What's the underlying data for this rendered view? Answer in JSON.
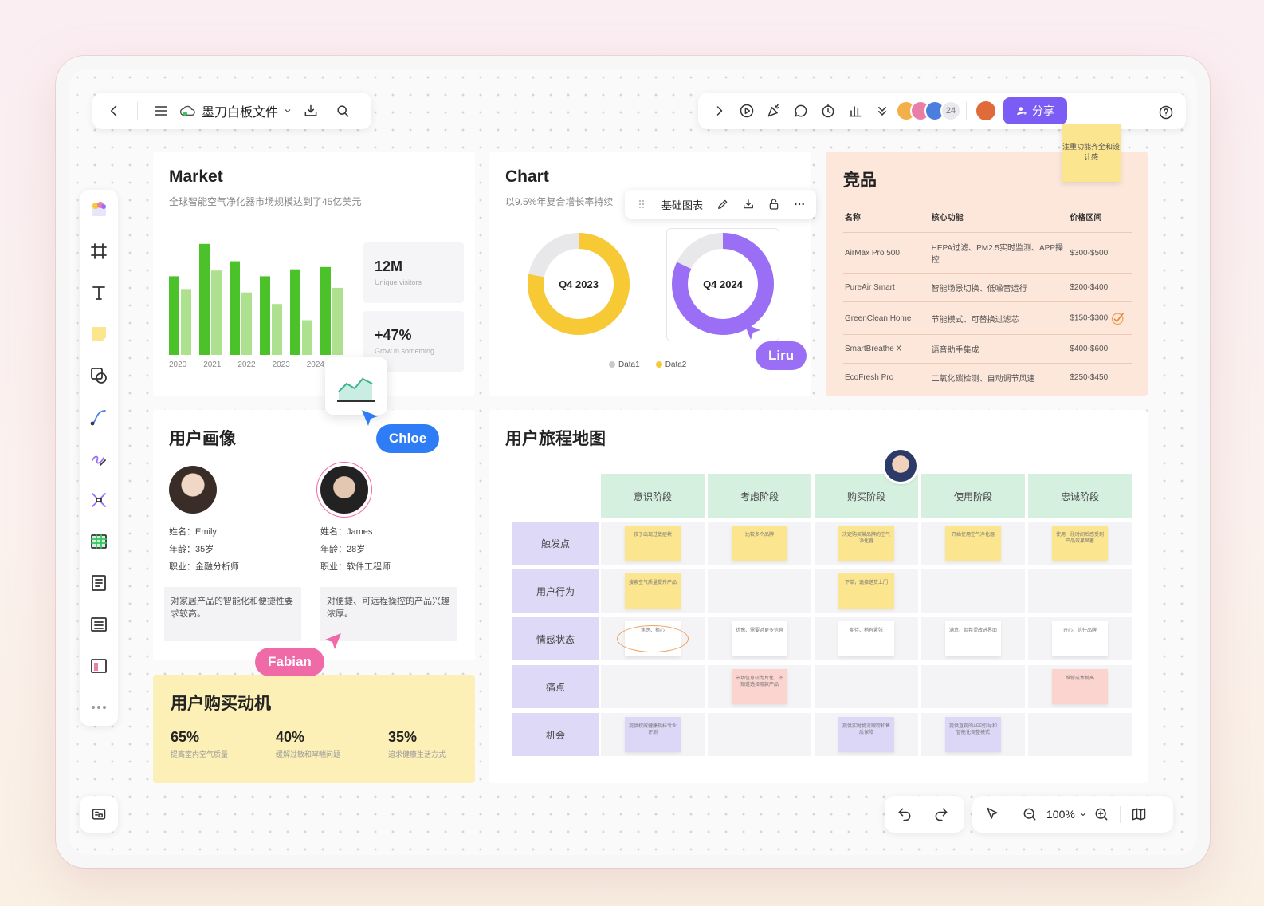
{
  "toolbar": {
    "doc_title": "墨刀白板文件",
    "share_label": "分享",
    "collaborator_count": "24"
  },
  "market": {
    "title": "Market",
    "subtitle": "全球智能空气净化器市场规模达到了45亿美元",
    "years": [
      "2020",
      "2021",
      "2022",
      "2023",
      "2024"
    ],
    "bars": [
      [
        68,
        57
      ],
      [
        96,
        73
      ],
      [
        81,
        54
      ],
      [
        68,
        44
      ],
      [
        74,
        30
      ],
      [
        76,
        58
      ]
    ],
    "stat1_value": "12M",
    "stat1_label": "Unique visitors",
    "stat2_value": "+47%",
    "stat2_label": "Grow in something"
  },
  "chart": {
    "title": "Chart",
    "subtitle": "以9.5%年复合增长率持续",
    "toolbar_label": "基础图表",
    "donut1_label": "Q4 2023",
    "donut2_label": "Q4 2024",
    "donut1_fraction": 0.78,
    "donut2_fraction": 0.82,
    "legend": [
      "Data1",
      "Data2"
    ],
    "colors": {
      "data1": "#c9c9cc",
      "data2": "#f6c935",
      "purple": "#9b6ff5",
      "track": "#e8e8ea"
    }
  },
  "compete": {
    "title": "竞品",
    "headers": [
      "名称",
      "核心功能",
      "价格区间"
    ],
    "rows": [
      [
        "AirMax Pro 500",
        "HEPA过滤、PM2.5实时监测、APP操控",
        "$300-$500"
      ],
      [
        "PureAir Smart",
        "智能场景切换、低噪音运行",
        "$200-$400"
      ],
      [
        "GreenClean Home",
        "节能模式、可替换过滤芯",
        "$150-$300"
      ],
      [
        "SmartBreathe X",
        "语音助手集成",
        "$400-$600"
      ],
      [
        "EcoFresh Pro",
        "二氧化碳检测、自动调节风速",
        "$250-$450"
      ]
    ],
    "sticky": "注重功能齐全和设计感"
  },
  "persona": {
    "title": "用户画像",
    "p1": {
      "name": "姓名：Emily",
      "age": "年龄：35岁",
      "job": "职业：金融分析师",
      "quote": "对家居产品的智能化和便捷性要求较高。"
    },
    "p2": {
      "name": "姓名：James",
      "age": "年龄：28岁",
      "job": "职业：软件工程师",
      "quote": "对便捷、可远程操控的产品兴趣浓厚。"
    }
  },
  "motive": {
    "title": "用户购买动机",
    "stats": [
      {
        "value": "65%",
        "label": "提高室内空气质量"
      },
      {
        "value": "40%",
        "label": "缓解过敏和哮喘问题"
      },
      {
        "value": "35%",
        "label": "追求健康生活方式"
      }
    ]
  },
  "journey": {
    "title": "用户旅程地图",
    "stages": [
      "意识阶段",
      "考虑阶段",
      "购买阶段",
      "使用阶段",
      "忠诚阶段"
    ],
    "rows": [
      "触发点",
      "用户行为",
      "情感状态",
      "痛点",
      "机会"
    ],
    "notes": {
      "r0": [
        "孩子出现过敏症状",
        "比较多个品牌",
        "决定购买某品牌的空气净化器",
        "开始使用空气净化器",
        "使用一段时间后感受到产品效果显著"
      ],
      "r1": [
        "搜索空气质量提升产品",
        "",
        "下单，选择送货上门",
        "",
        ""
      ],
      "r2": [
        "焦虑、担心",
        "犹豫、需要对更多信息",
        "期待、稍有紧张",
        "满意、但希望改进界面",
        "开心、信任品牌"
      ],
      "r3": [
        "",
        "市场信息较为片化，不知道选择哪款产品",
        "",
        "",
        "维修成本稍高"
      ],
      "r4": [
        "提供权威健康指标专业评测",
        "",
        "提供实时物流跟踪和售后保障",
        "提供直观的APP引导和智能化调整模式",
        ""
      ]
    }
  },
  "cursors": {
    "chloe": "Chloe",
    "liru": "Liru",
    "fabian": "Fabian"
  },
  "zoom": "100%"
}
